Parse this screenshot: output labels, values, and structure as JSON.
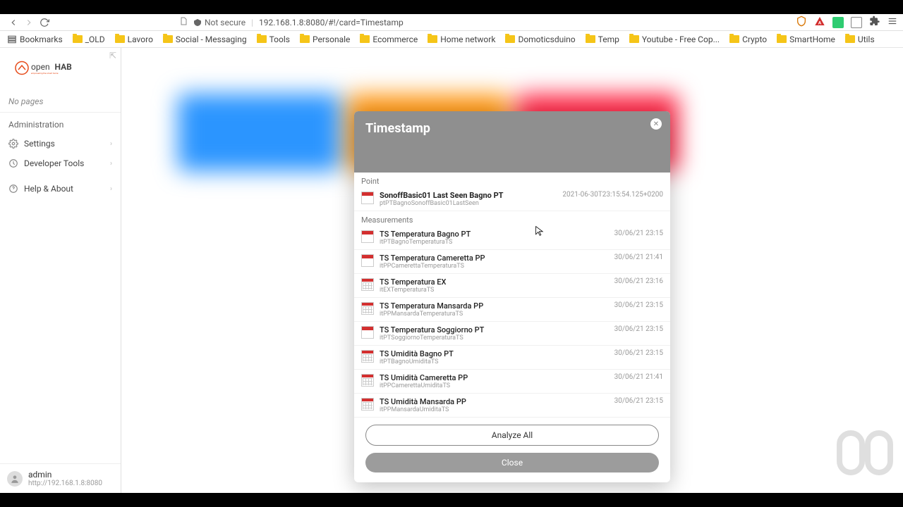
{
  "browser": {
    "not_secure": "Not secure",
    "url": "192.168.1.8:8080/#!/card=Timestamp"
  },
  "bookmarks": [
    {
      "label": "Bookmarks",
      "icon": "list"
    },
    {
      "label": "_OLD"
    },
    {
      "label": "Lavoro"
    },
    {
      "label": "Social - Messaging"
    },
    {
      "label": "Tools"
    },
    {
      "label": "Personale"
    },
    {
      "label": "Ecommerce"
    },
    {
      "label": "Home network"
    },
    {
      "label": "Domoticsduino"
    },
    {
      "label": "Temp"
    },
    {
      "label": "Youtube - Free Cop..."
    },
    {
      "label": "Crypto"
    },
    {
      "label": "SmartHome"
    },
    {
      "label": "Utils"
    }
  ],
  "sidebar": {
    "no_pages": "No pages",
    "admin_label": "Administration",
    "items": [
      {
        "label": "Settings"
      },
      {
        "label": "Developer Tools"
      },
      {
        "label": "Help & About"
      }
    ],
    "user": {
      "name": "admin",
      "url": "http://192.168.1.8:8080"
    }
  },
  "modal": {
    "title": "Timestamp",
    "point_label": "Point",
    "measurements_label": "Measurements",
    "point": {
      "title": "SonoffBasic01 Last Seen Bagno PT",
      "sub": "ptPTBagnoSonoffBasic01LastSeen",
      "value": "2021-06-30T23:15:54.125+0200"
    },
    "measurements": [
      {
        "title": "TS Temperatura Bagno PT",
        "sub": "itPTBagnoTemperaturaTS",
        "value": "30/06/21 23:15"
      },
      {
        "title": "TS Temperatura Cameretta PP",
        "sub": "itPPCamerettaTemperaturaTS",
        "value": "30/06/21 21:41"
      },
      {
        "title": "TS Temperatura EX",
        "sub": "itEXTemperaturaTS",
        "value": "30/06/21 23:16"
      },
      {
        "title": "TS Temperatura Mansarda PP",
        "sub": "itPPMansardaTemperaturaTS",
        "value": "30/06/21 23:15"
      },
      {
        "title": "TS Temperatura Soggiorno PT",
        "sub": "itPTSoggiornoTemperaturaTS",
        "value": "30/06/21 23:15"
      },
      {
        "title": "TS Umidità Bagno PT",
        "sub": "itPTBagnoUmiditaTS",
        "value": "30/06/21 23:15"
      },
      {
        "title": "TS Umidità Cameretta PP",
        "sub": "itPPCamerettaUmiditaTS",
        "value": "30/06/21 21:41"
      },
      {
        "title": "TS Umidità Mansarda PP",
        "sub": "itPPMansardaUmiditaTS",
        "value": "30/06/21 23:15"
      }
    ],
    "analyze": "Analyze All",
    "close": "Close"
  }
}
